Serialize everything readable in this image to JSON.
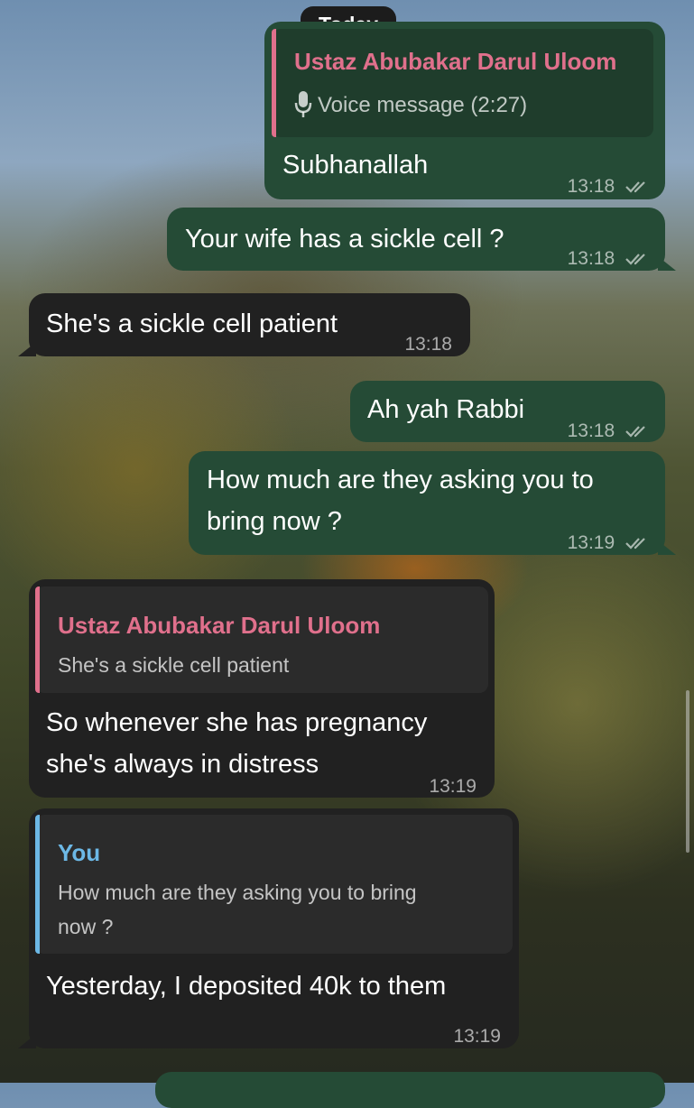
{
  "date_separator": "Today",
  "colors": {
    "outgoing_bubble": "#254b36",
    "incoming_bubble": "#212121",
    "reply_name_contact": "#e0708c",
    "reply_name_self": "#6cb8e6"
  },
  "messages": [
    {
      "direction": "outgoing",
      "reply": {
        "name": "Ustaz Abubakar Darul Uloom",
        "icon": "microphone-icon",
        "text": "Voice message (2:27)"
      },
      "text": "Subhanallah",
      "time": "13:18",
      "status": "read"
    },
    {
      "direction": "outgoing",
      "text": "Your wife has a sickle cell ?",
      "time": "13:18",
      "status": "read"
    },
    {
      "direction": "incoming",
      "text": "She's a sickle cell patient",
      "time": "13:18"
    },
    {
      "direction": "outgoing",
      "text": "Ah yah Rabbi",
      "time": "13:18",
      "status": "read"
    },
    {
      "direction": "outgoing",
      "lines": [
        "How much are they asking you to",
        "bring now ?"
      ],
      "time": "13:19",
      "status": "read"
    },
    {
      "direction": "incoming",
      "reply": {
        "name": "Ustaz Abubakar Darul Uloom",
        "text": "She's a sickle cell patient"
      },
      "lines": [
        "So whenever she has pregnancy",
        "she's always in distress"
      ],
      "time": "13:19"
    },
    {
      "direction": "incoming",
      "reply": {
        "name": "You",
        "lines": [
          "How much are they asking you to bring",
          "now ?"
        ]
      },
      "text": "Yesterday, I deposited 40k to them",
      "time": "13:19"
    }
  ]
}
